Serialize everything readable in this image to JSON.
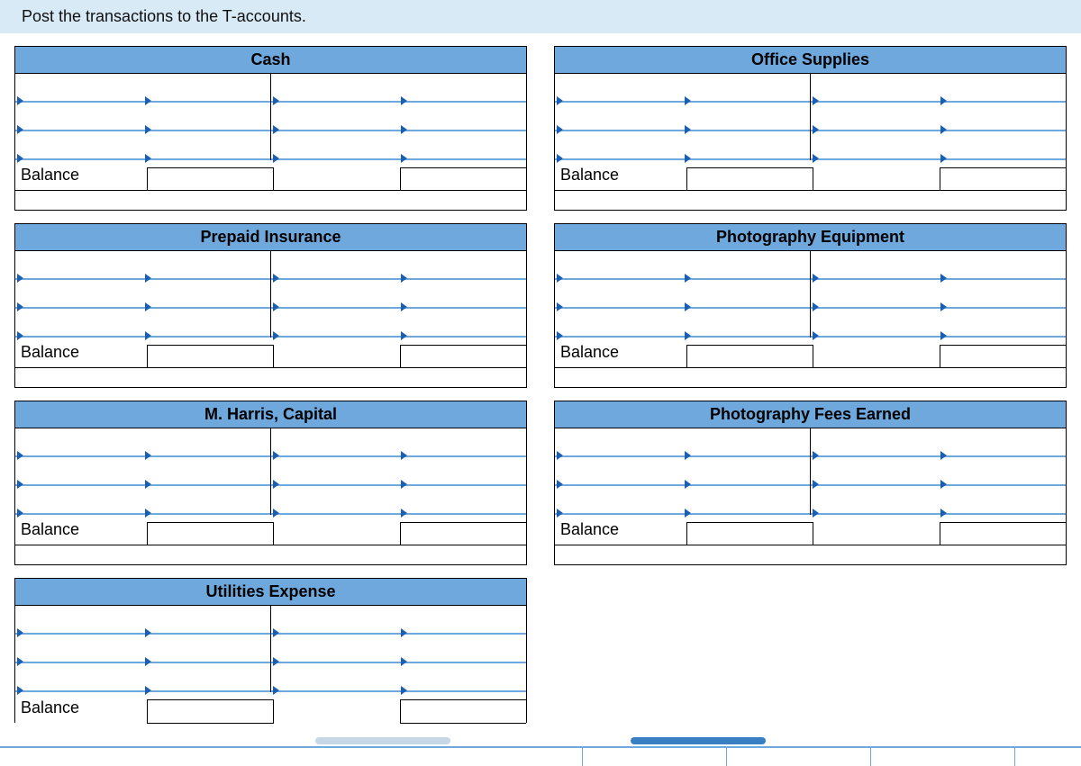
{
  "instruction": "Post the transactions to the T-accounts.",
  "balance_label": "Balance",
  "left_column": [
    {
      "title": "Cash"
    },
    {
      "title": "Prepaid Insurance"
    },
    {
      "title": "M. Harris, Capital"
    },
    {
      "title": "Utilities Expense"
    }
  ],
  "right_column": [
    {
      "title": "Office Supplies"
    },
    {
      "title": "Photography Equipment"
    },
    {
      "title": "Photography Fees Earned"
    }
  ]
}
